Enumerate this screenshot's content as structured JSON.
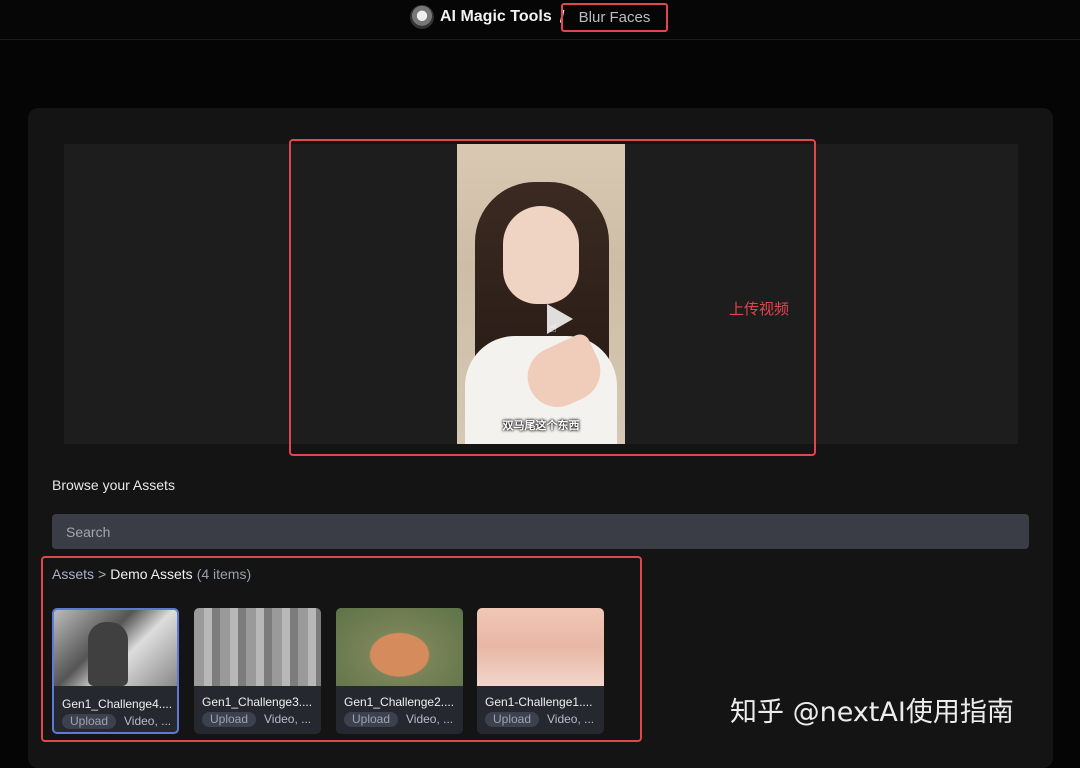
{
  "header": {
    "app_name": "AI Magic Tools",
    "separator": "/",
    "breadcrumb": "Blur Faces"
  },
  "preview": {
    "subtitle": "双马尾这个东西",
    "annotation": "上传视频"
  },
  "assets": {
    "title": "Browse your Assets",
    "search_placeholder": "Search",
    "breadcrumb_root": "Assets",
    "breadcrumb_sep": ">",
    "breadcrumb_current": "Demo Assets",
    "count": "(4 items)",
    "items": [
      {
        "name": "Gen1_Challenge4....",
        "tag": "Upload",
        "types": "Video, ..."
      },
      {
        "name": "Gen1_Challenge3....",
        "tag": "Upload",
        "types": "Video, ..."
      },
      {
        "name": "Gen1_Challenge2....",
        "tag": "Upload",
        "types": "Video, ..."
      },
      {
        "name": "Gen1-Challenge1....",
        "tag": "Upload",
        "types": "Video, ..."
      }
    ]
  },
  "watermark": "知乎 @nextAI使用指南"
}
